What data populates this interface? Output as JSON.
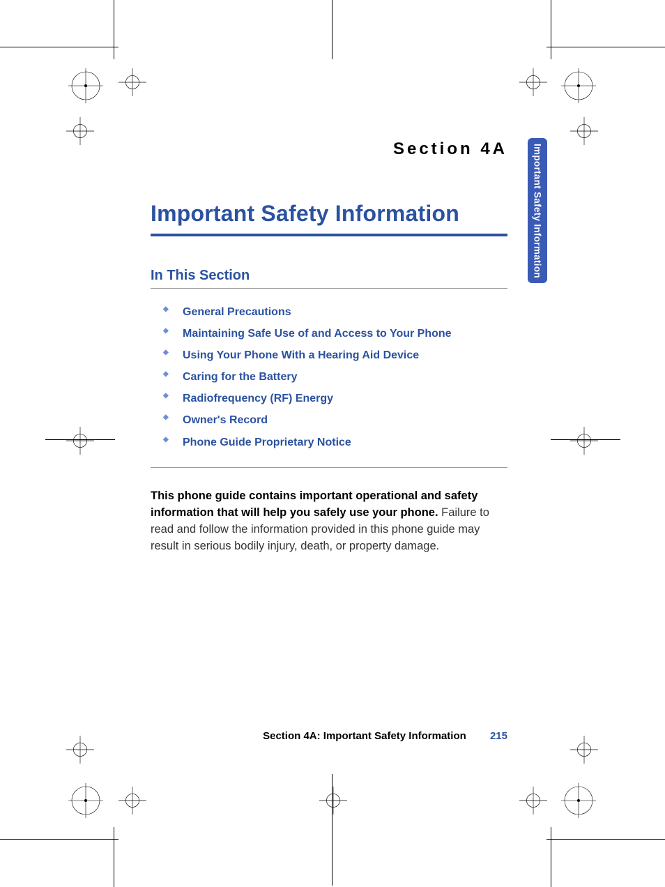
{
  "section_label": "Section 4A",
  "main_title": "Important Safety Information",
  "side_tab": "Important Safety Information",
  "subheading": "In This Section",
  "toc": [
    "General Precautions",
    "Maintaining Safe Use of and Access to Your Phone",
    "Using Your Phone With a Hearing Aid Device",
    "Caring for the Battery",
    "Radiofrequency (RF) Energy",
    "Owner's Record",
    "Phone Guide Proprietary Notice"
  ],
  "body_bold": "This phone guide contains important operational and safety information that will help you safely use your phone.",
  "body_rest": " Failure to read and follow the information provided in this phone guide may result in serious bodily injury, death, or property damage.",
  "footer_label": "Section 4A: Important Safety Information",
  "page_number": "215"
}
